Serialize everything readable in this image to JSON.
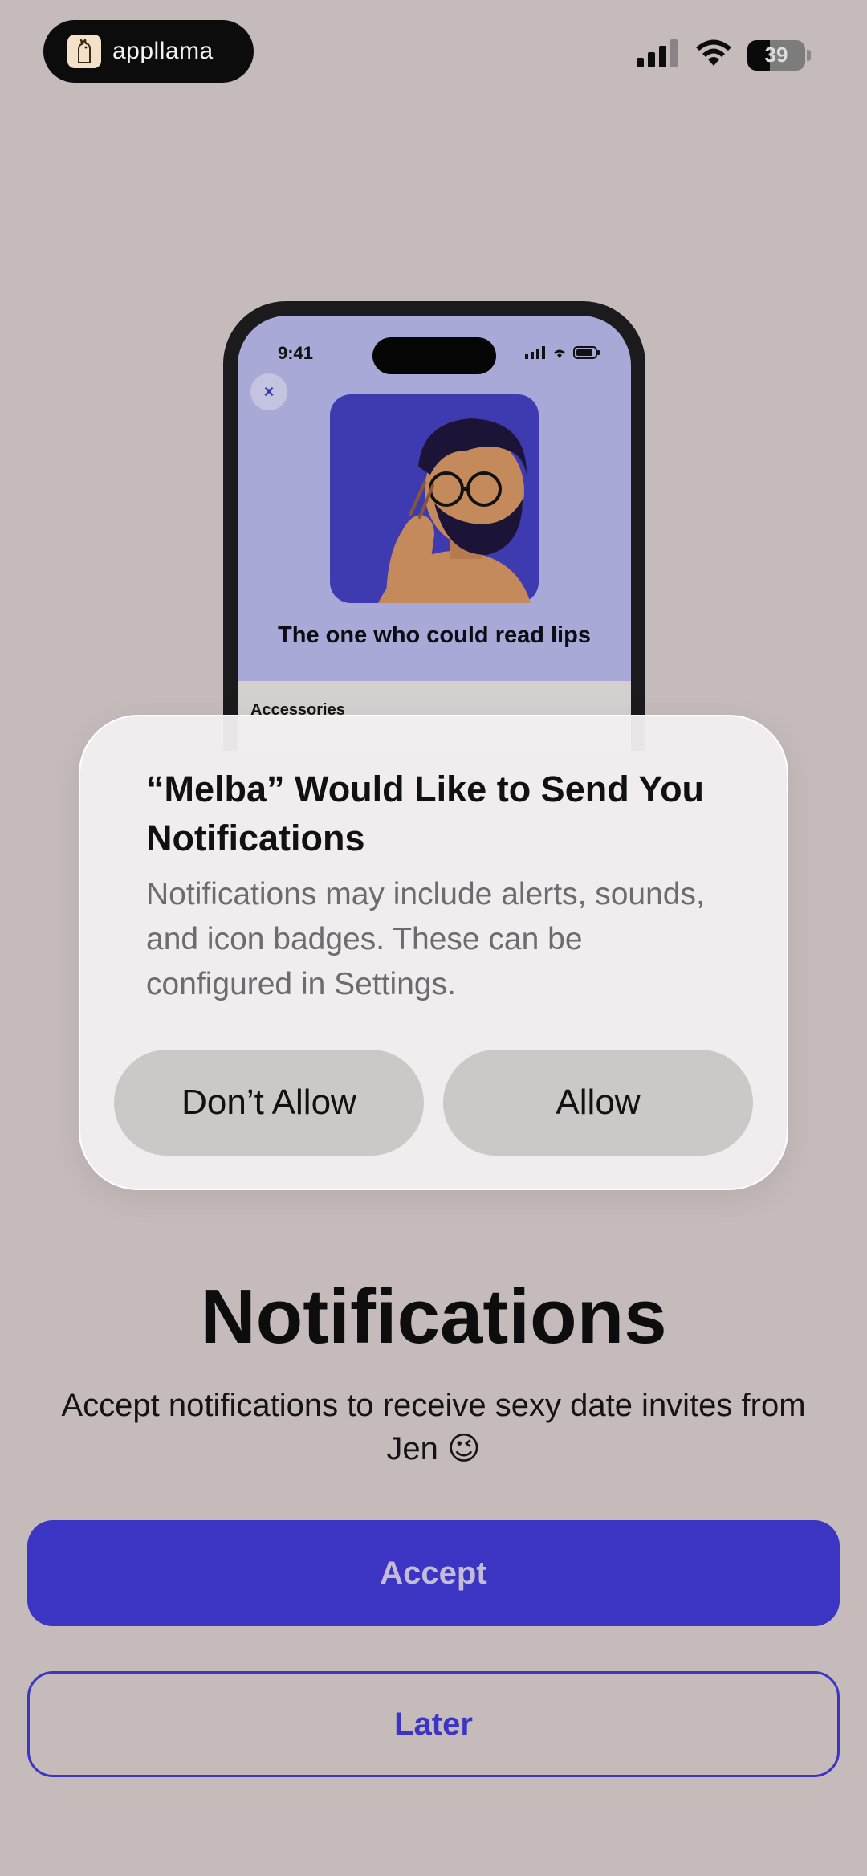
{
  "status_bar": {
    "brand_name": "appllama",
    "battery_level": "39",
    "icons": [
      "signal-icon",
      "wifi-icon",
      "battery-icon"
    ]
  },
  "phone_mockup": {
    "time": "9:41",
    "close_symbol": "×",
    "caption": "The one who could read lips",
    "sheet_title": "Accessories",
    "colors": {
      "screen": "#a9a9d8",
      "art": "#3e3ab0"
    }
  },
  "alert": {
    "title": "“Melba” Would Like to Send You Notifications",
    "body": "Notifications may include alerts, sounds, and icon badges. These can be configured in Settings.",
    "deny_label": "Don’t Allow",
    "allow_label": "Allow"
  },
  "page": {
    "title": "Notifications",
    "subtitle": "Accept notifications to receive sexy date invites from Jen 😉",
    "accept_label": "Accept",
    "later_label": "Later"
  },
  "colors": {
    "background": "#c6bbbb",
    "accent": "#3c34c2"
  }
}
